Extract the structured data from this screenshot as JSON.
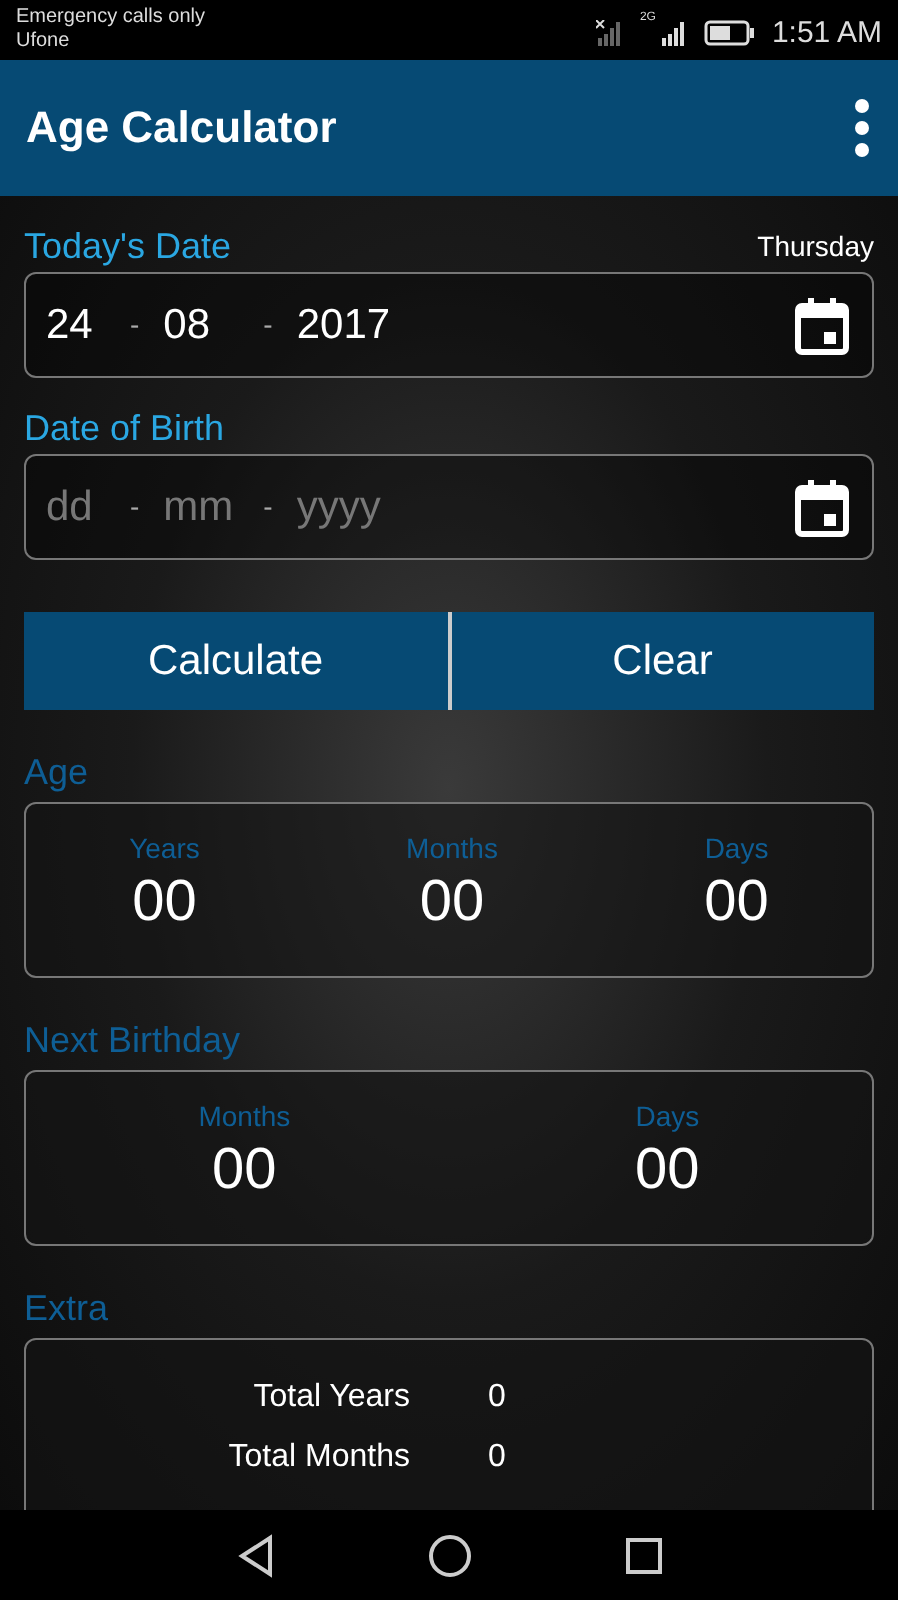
{
  "status_bar": {
    "carrier_lines": [
      "Emergency calls only",
      "Ufone"
    ],
    "network": "2G",
    "time": "1:51 AM"
  },
  "app_bar": {
    "title": "Age Calculator"
  },
  "date_fields": [
    {
      "label": "Today's Date",
      "weekday": "Thursday",
      "parts": [
        {
          "value": "24"
        },
        {
          "value": "08"
        },
        {
          "value": "2017"
        }
      ],
      "separators": [
        "-",
        "-"
      ]
    },
    {
      "label": "Date of Birth",
      "parts": [
        {
          "placeholder": "dd"
        },
        {
          "placeholder": "mm"
        },
        {
          "placeholder": "yyyy"
        }
      ],
      "separators": [
        "-",
        "-"
      ]
    }
  ],
  "buttons": [
    "Calculate",
    "Clear"
  ],
  "sections": [
    {
      "title": "Age",
      "cells": [
        {
          "label": "Years",
          "value": "00"
        },
        {
          "label": "Months",
          "value": "00"
        },
        {
          "label": "Days",
          "value": "00"
        }
      ]
    },
    {
      "title": "Next Birthday",
      "cells": [
        {
          "label": "Months",
          "value": "00"
        },
        {
          "label": "Days",
          "value": "00"
        }
      ]
    }
  ],
  "extra": {
    "title": "Extra",
    "rows": [
      {
        "label": "Total Years",
        "value": "0"
      },
      {
        "label": "Total Months",
        "value": "0"
      }
    ]
  }
}
